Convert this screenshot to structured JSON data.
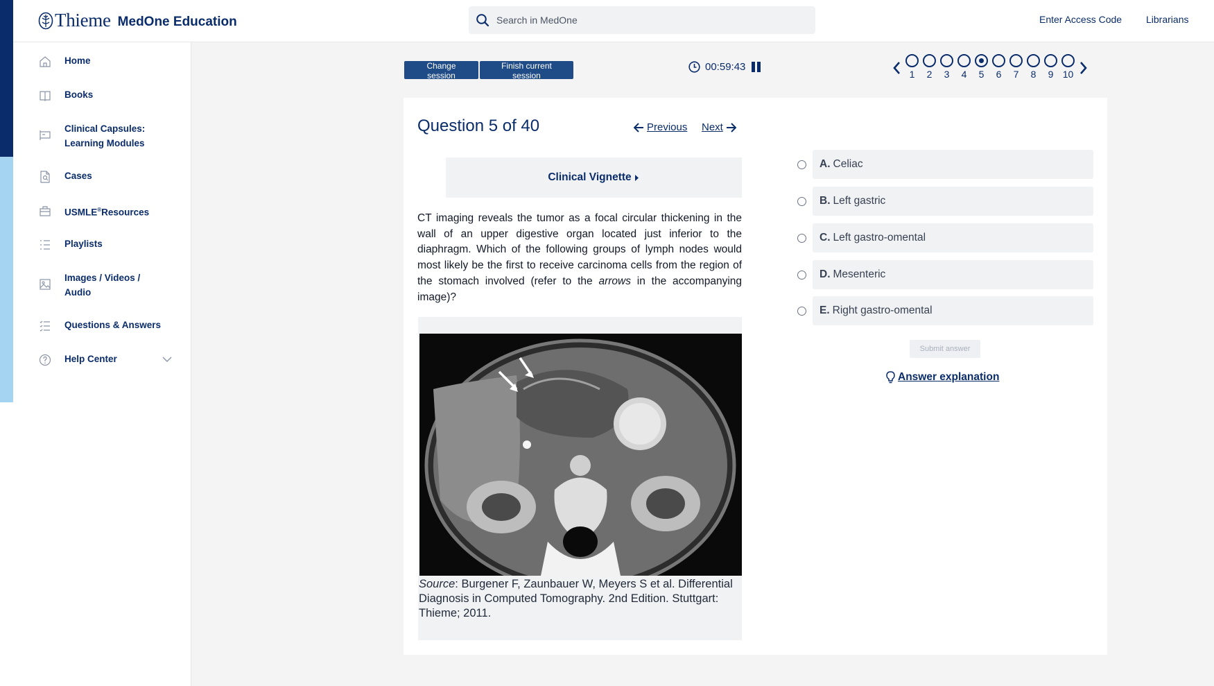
{
  "header": {
    "brand": "Thieme",
    "product": "MedOne Education",
    "search_placeholder": "Search in MedOne",
    "enter_access_code": "Enter Access Code",
    "librarians": "Librarians"
  },
  "sidebar": {
    "items": [
      {
        "label": "Home",
        "icon": "home-icon"
      },
      {
        "label": "Books",
        "icon": "book-icon"
      },
      {
        "label_line1": "Clinical Capsules:",
        "label_line2": "Learning Modules",
        "icon": "presentation-icon"
      },
      {
        "label": "Cases",
        "icon": "case-file-icon"
      },
      {
        "label": "USMLE",
        "sup": "®",
        "label_rest": "Resources",
        "icon": "briefcase-icon"
      },
      {
        "label": "Playlists",
        "icon": "list-icon"
      },
      {
        "label_line1": "Images / Videos /",
        "label_line2": "Audio",
        "icon": "image-icon"
      },
      {
        "label": "Questions & Answers",
        "icon": "checklist-icon"
      },
      {
        "label": "Help Center",
        "icon": "question-circle-icon"
      }
    ]
  },
  "session": {
    "change_session": "Change session",
    "finish_session": "Finish current session",
    "timer": "00:59:43"
  },
  "question_nav": {
    "numbers": [
      "1",
      "2",
      "3",
      "4",
      "5",
      "6",
      "7",
      "8",
      "9",
      "10"
    ],
    "current": 5
  },
  "question": {
    "title": "Question 5 of 40",
    "previous": "Previous",
    "next": "Next",
    "vignette_label": "Clinical Vignette",
    "stem_before": "CT imaging reveals the tumor as a focal circular thickening in the wall of an upper digestive organ located just inferior to the diaphragm. Which of the following groups of lymph nodes would most likely be the first to receive carcinoma cells from the region of the stomach involved (refer to the ",
    "stem_em": "arrows",
    "stem_after": " in the accompanying image)?",
    "source_label": "Source",
    "source_text": ": Burgener F, Zaunbauer W, Meyers S et al. Differential Diagnosis in Computed Tomography. 2nd Edition. Stuttgart: Thieme; 2011."
  },
  "answers": [
    {
      "letter": "A.",
      "text": "Celiac"
    },
    {
      "letter": "B.",
      "text": "Left gastric"
    },
    {
      "letter": "C.",
      "text": "Left gastro-omental"
    },
    {
      "letter": "D.",
      "text": "Mesenteric"
    },
    {
      "letter": "E.",
      "text": "Right gastro-omental"
    }
  ],
  "submit_label": "Submit answer",
  "explanation_label": "Answer explanation",
  "colors": {
    "brand_navy": "#0a2c6b",
    "button_blue": "#1f4b87",
    "accent_light_blue": "#a5d4f3"
  }
}
